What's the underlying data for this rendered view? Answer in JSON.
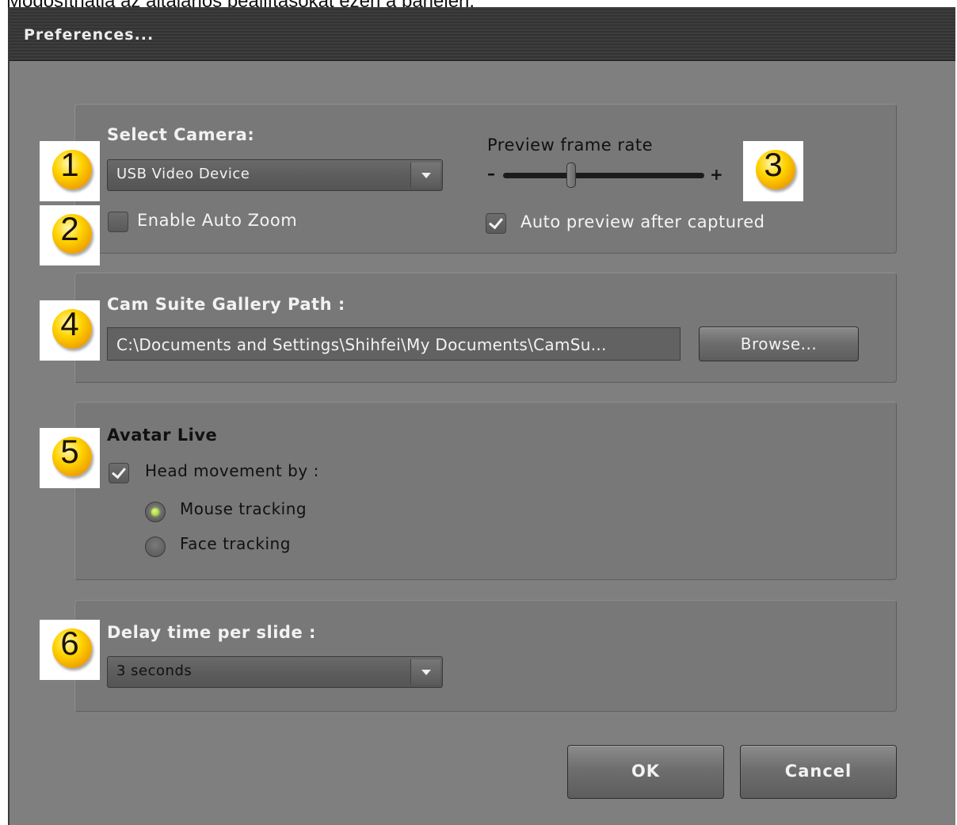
{
  "caption": "Módosíthatja az általános beállításokat ezen a panelen.",
  "window": {
    "title": "Preferences..."
  },
  "camera": {
    "label": "Select Camera:",
    "device": "USB Video Device",
    "auto_zoom_label": "Enable Auto Zoom",
    "auto_zoom_checked": false
  },
  "preview": {
    "label": "Preview frame rate",
    "minus": "–",
    "plus": "+",
    "slider_value_fraction": 0.34,
    "auto_preview_label": "Auto preview after captured",
    "auto_preview_checked": true
  },
  "gallery": {
    "label": "Cam Suite Gallery Path :",
    "path": "C:\\Documents and Settings\\Shihfei\\My Documents\\CamSu...",
    "browse_label": "Browse..."
  },
  "avatar": {
    "label": "Avatar Live",
    "head_movement_label": "Head movement by :",
    "head_movement_checked": true,
    "options": [
      {
        "label": "Mouse tracking",
        "selected": true
      },
      {
        "label": "Face tracking",
        "selected": false
      }
    ]
  },
  "delay": {
    "label": "Delay time per slide :",
    "value": "3 seconds"
  },
  "buttons": {
    "ok": "OK",
    "cancel": "Cancel"
  },
  "badges": [
    "1",
    "2",
    "3",
    "4",
    "5",
    "6"
  ],
  "colors": {
    "dialog_bg": "#7f7f7f",
    "titlebar": "#3a3a3a",
    "badge": "#ffd400",
    "radio_on": "#a8e030"
  }
}
